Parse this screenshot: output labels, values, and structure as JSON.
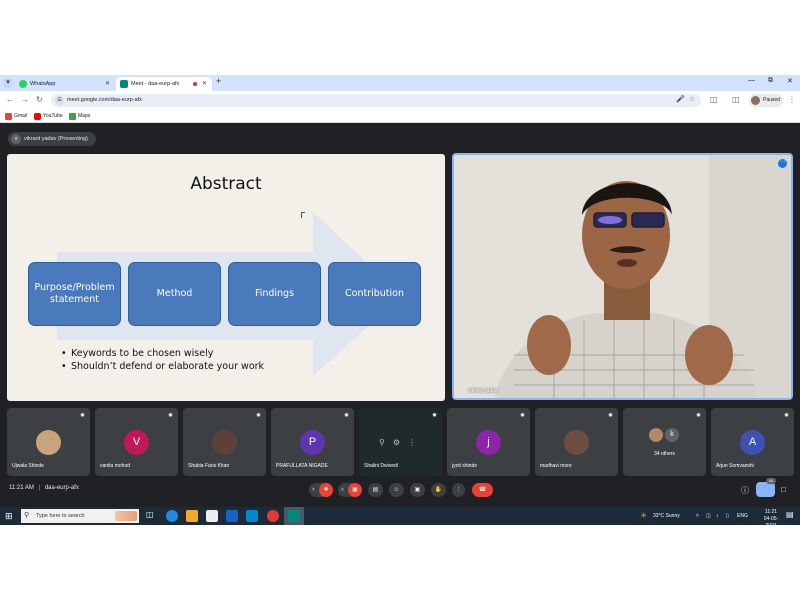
{
  "browser": {
    "tabs": [
      {
        "label": "WhatsApp",
        "favicon": "whatsapp-icon",
        "active": false
      },
      {
        "label": "Meet - daa-eurp-afx",
        "favicon": "meet-icon",
        "active": true,
        "recording": true
      }
    ],
    "url": "meet.google.com/daa-eurp-afx",
    "profile_label": "Paused",
    "bookmarks": [
      {
        "label": "Gmail",
        "icon": "gmail-icon",
        "color": "#ea4335"
      },
      {
        "label": "YouTube",
        "icon": "youtube-icon",
        "color": "#ff0000"
      },
      {
        "label": "Maps",
        "icon": "maps-icon",
        "color": "#34a853"
      }
    ]
  },
  "meet": {
    "presenter_initial": "v",
    "presenting_label": "vikrant yadav (Presenting)",
    "slide": {
      "title": "Abstract",
      "boxes": [
        "Purpose/Problem statement",
        "Method",
        "Findings",
        "Contribution"
      ],
      "bullets": [
        "Keywords to be chosen wisely",
        "Shouldn’t defend or elaborate your work"
      ]
    },
    "speaker": {
      "name": "vikrant yadav"
    },
    "participants": [
      {
        "name": "Ujwala Shinde",
        "avatar": "photo",
        "color": "#c9a47a"
      },
      {
        "name": "vanita mohod",
        "avatar": "V",
        "color": "#c2185b"
      },
      {
        "name": "Shabia Faris Khan",
        "avatar": "photo",
        "color": "#5d4037"
      },
      {
        "name": "PRAFULLATA NIGADE",
        "avatar": "P",
        "color": "#5e35b1"
      },
      {
        "name": "Shalini Dwivedi",
        "avatar": "video",
        "color": "#1f2a2a"
      },
      {
        "name": "jyoti shinde",
        "avatar": "j",
        "color": "#8e24aa"
      },
      {
        "name": "madhavi more",
        "avatar": "photo",
        "color": "#6d4c41"
      },
      {
        "name": "34 others",
        "avatar": "k",
        "color": "#5f6368"
      },
      {
        "name": "Arjun Somvanshi",
        "avatar": "A",
        "color": "#3f51b5"
      }
    ],
    "bottom_bar": {
      "time": "11:21 AM",
      "separator": "|",
      "meeting_code": "daa-eurp-afx",
      "people_count": "44"
    }
  },
  "taskbar": {
    "search_placeholder": "Type here to search",
    "weather": "33°C  Sunny",
    "language": "ENG",
    "time": "11:21",
    "date": "04-05-2024"
  }
}
